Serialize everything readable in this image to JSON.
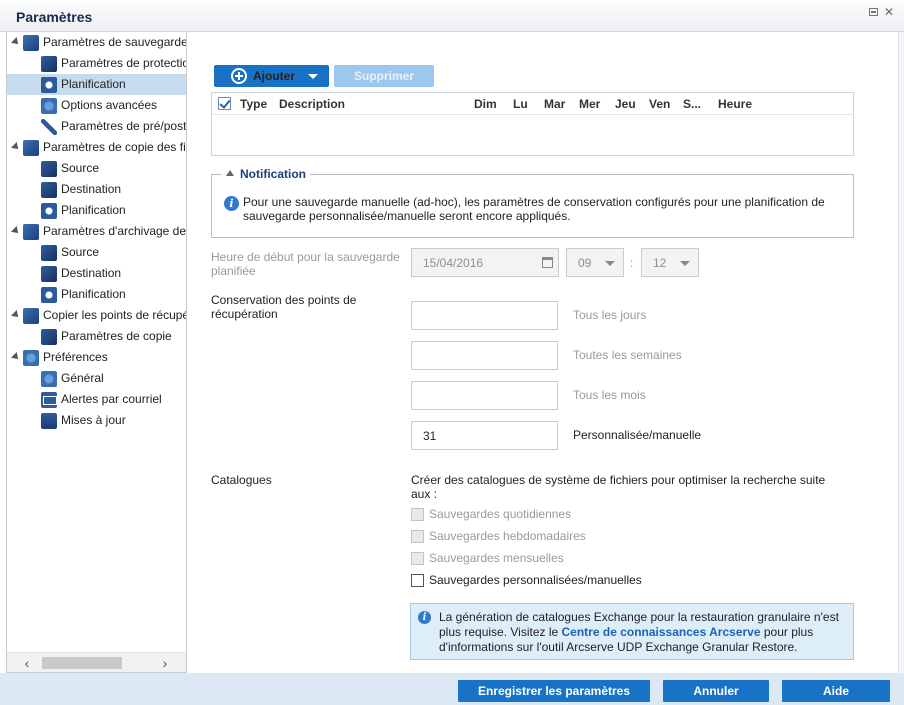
{
  "window": {
    "title": "Paramètres"
  },
  "tree": {
    "items": [
      {
        "label": "Paramètres de sauvegarde",
        "level": 0,
        "icon": "backup-settings-icon"
      },
      {
        "label": "Paramètres de protection",
        "level": 1,
        "icon": "protection-settings-icon"
      },
      {
        "label": "Planification",
        "level": 1,
        "icon": "schedule-icon",
        "selected": true
      },
      {
        "label": "Options avancées",
        "level": 1,
        "icon": "advanced-options-icon"
      },
      {
        "label": "Paramètres de pré/post",
        "level": 1,
        "icon": "tools-icon"
      },
      {
        "label": "Paramètres de copie des fichiers",
        "level": 0,
        "icon": "file-copy-icon"
      },
      {
        "label": "Source",
        "level": 1,
        "icon": "source-icon"
      },
      {
        "label": "Destination",
        "level": 1,
        "icon": "destination-icon"
      },
      {
        "label": "Planification",
        "level": 1,
        "icon": "schedule-icon"
      },
      {
        "label": "Paramètres d'archivage des fichiers",
        "level": 0,
        "icon": "file-archive-icon"
      },
      {
        "label": "Source",
        "level": 1,
        "icon": "source-icon"
      },
      {
        "label": "Destination",
        "level": 1,
        "icon": "destination-icon"
      },
      {
        "label": "Planification",
        "level": 1,
        "icon": "schedule-icon"
      },
      {
        "label": "Copier les points de récupération",
        "level": 0,
        "icon": "copy-recovery-icon"
      },
      {
        "label": "Paramètres de copie",
        "level": 1,
        "icon": "copy-settings-icon"
      },
      {
        "label": "Préférences",
        "level": 0,
        "icon": "preferences-icon"
      },
      {
        "label": "Général",
        "level": 1,
        "icon": "general-icon"
      },
      {
        "label": "Alertes par courriel",
        "level": 1,
        "icon": "email-alert-icon"
      },
      {
        "label": "Mises à jour",
        "level": 1,
        "icon": "updates-icon"
      }
    ]
  },
  "toolbar": {
    "add_label": "Ajouter",
    "delete_label": "Supprimer"
  },
  "schedule_table": {
    "columns": [
      "Type",
      "Description",
      "Dim",
      "Lu",
      "Mar",
      "Mer",
      "Jeu",
      "Ven",
      "S...",
      "Heure"
    ]
  },
  "notification": {
    "title": "Notification",
    "text": "Pour une sauvegarde manuelle (ad-hoc), les paramètres de conservation configurés pour une planification de sauvegarde personnalisée/manuelle seront encore appliqués."
  },
  "start_time": {
    "label": "Heure de début pour la sauvegarde planifiée",
    "date": "15/04/2016",
    "hour": "09",
    "separator": ":",
    "minute": "12"
  },
  "retention": {
    "label": "Conservation des points de récupération",
    "rows": [
      {
        "value": "",
        "label": "Tous les jours",
        "enabled": false
      },
      {
        "value": "",
        "label": "Toutes les semaines",
        "enabled": false
      },
      {
        "value": "",
        "label": "Tous les mois",
        "enabled": false
      },
      {
        "value": "31",
        "label": "Personnalisée/manuelle",
        "enabled": true
      }
    ]
  },
  "catalogs": {
    "label": "Catalogues",
    "description": "Créer des catalogues de système de fichiers pour optimiser la recherche suite aux :",
    "options": [
      {
        "label": "Sauvegardes quotidiennes",
        "enabled": false
      },
      {
        "label": "Sauvegardes hebdomadaires",
        "enabled": false
      },
      {
        "label": "Sauvegardes mensuelles",
        "enabled": false
      },
      {
        "label": "Sauvegardes personnalisées/manuelles",
        "enabled": true
      }
    ]
  },
  "exchange_info": {
    "text_before": "La génération de catalogues Exchange pour la restauration granulaire n'est plus requise. Visitez le ",
    "link": "Centre de connaissances Arcserve",
    "text_after": " pour plus d'informations sur l'outil Arcserve UDP Exchange Granular Restore."
  },
  "footer": {
    "save_label": "Enregistrer les paramètres",
    "cancel_label": "Annuler",
    "help_label": "Aide"
  },
  "colors": {
    "accent": "#1873c6",
    "selection": "#c7dbef",
    "info_bg": "#ddeef9",
    "footer_bg": "#dde8f5"
  }
}
